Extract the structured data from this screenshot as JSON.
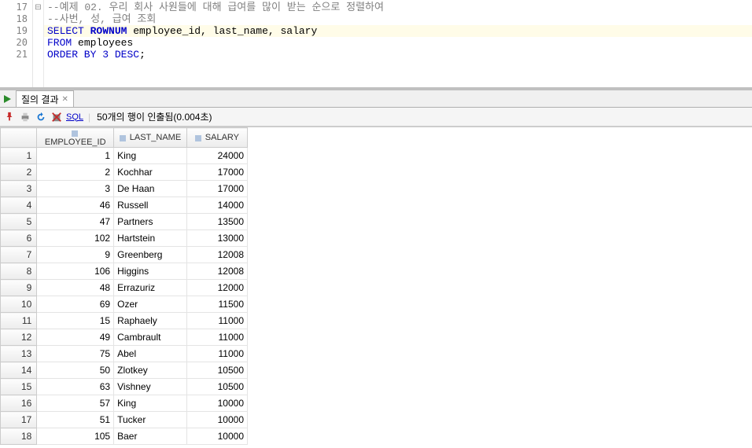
{
  "editor": {
    "lines": [
      {
        "num": 17,
        "fold": "⊟",
        "hl": false,
        "segments": [
          {
            "cls": "c-comment",
            "t": "--예제 02. 우리 회사 사원들에 대해 급여를 많이 받는 순으로 정렬하여"
          }
        ]
      },
      {
        "num": 18,
        "fold": "",
        "hl": false,
        "segments": [
          {
            "cls": "c-comment",
            "t": "--사번, 성, 급여 조회"
          }
        ]
      },
      {
        "num": 19,
        "fold": "",
        "hl": true,
        "segments": [
          {
            "cls": "c-keyword",
            "t": "SELECT"
          },
          {
            "cls": "",
            "t": " "
          },
          {
            "cls": "c-func",
            "t": "ROWNUM"
          },
          {
            "cls": "",
            "t": " employee_id, last_name, salary"
          }
        ]
      },
      {
        "num": 20,
        "fold": "",
        "hl": false,
        "segments": [
          {
            "cls": "c-keyword",
            "t": "FROM"
          },
          {
            "cls": "",
            "t": " employees"
          }
        ]
      },
      {
        "num": 21,
        "fold": "",
        "hl": false,
        "segments": [
          {
            "cls": "c-keyword",
            "t": "ORDER BY"
          },
          {
            "cls": "",
            "t": " "
          },
          {
            "cls": "c-num",
            "t": "3"
          },
          {
            "cls": "",
            "t": " "
          },
          {
            "cls": "c-keyword",
            "t": "DESC"
          },
          {
            "cls": "",
            "t": ";"
          }
        ]
      }
    ]
  },
  "tabs": {
    "result_label": "질의 결과"
  },
  "toolbar": {
    "sql_label": "SQL",
    "status": "50개의 행이 인출됨(0.004초)"
  },
  "grid": {
    "headers": [
      "EMPLOYEE_ID",
      "LAST_NAME",
      "SALARY"
    ],
    "rows": [
      {
        "n": 1,
        "emp": 1,
        "last": "King",
        "sal": "24000"
      },
      {
        "n": 2,
        "emp": 2,
        "last": "Kochhar",
        "sal": "17000"
      },
      {
        "n": 3,
        "emp": 3,
        "last": "De Haan",
        "sal": "17000"
      },
      {
        "n": 4,
        "emp": 46,
        "last": "Russell",
        "sal": "14000"
      },
      {
        "n": 5,
        "emp": 47,
        "last": "Partners",
        "sal": "13500"
      },
      {
        "n": 6,
        "emp": 102,
        "last": "Hartstein",
        "sal": "13000"
      },
      {
        "n": 7,
        "emp": 9,
        "last": "Greenberg",
        "sal": "12008"
      },
      {
        "n": 8,
        "emp": 106,
        "last": "Higgins",
        "sal": "12008"
      },
      {
        "n": 9,
        "emp": 48,
        "last": "Errazuriz",
        "sal": "12000"
      },
      {
        "n": 10,
        "emp": 69,
        "last": "Ozer",
        "sal": "11500"
      },
      {
        "n": 11,
        "emp": 15,
        "last": "Raphaely",
        "sal": "11000"
      },
      {
        "n": 12,
        "emp": 49,
        "last": "Cambrault",
        "sal": "11000"
      },
      {
        "n": 13,
        "emp": 75,
        "last": "Abel",
        "sal": "11000"
      },
      {
        "n": 14,
        "emp": 50,
        "last": "Zlotkey",
        "sal": "10500"
      },
      {
        "n": 15,
        "emp": 63,
        "last": "Vishney",
        "sal": "10500"
      },
      {
        "n": 16,
        "emp": 57,
        "last": "King",
        "sal": "10000"
      },
      {
        "n": 17,
        "emp": 51,
        "last": "Tucker",
        "sal": "10000"
      },
      {
        "n": 18,
        "emp": 105,
        "last": "Baer",
        "sal": "10000"
      }
    ]
  }
}
